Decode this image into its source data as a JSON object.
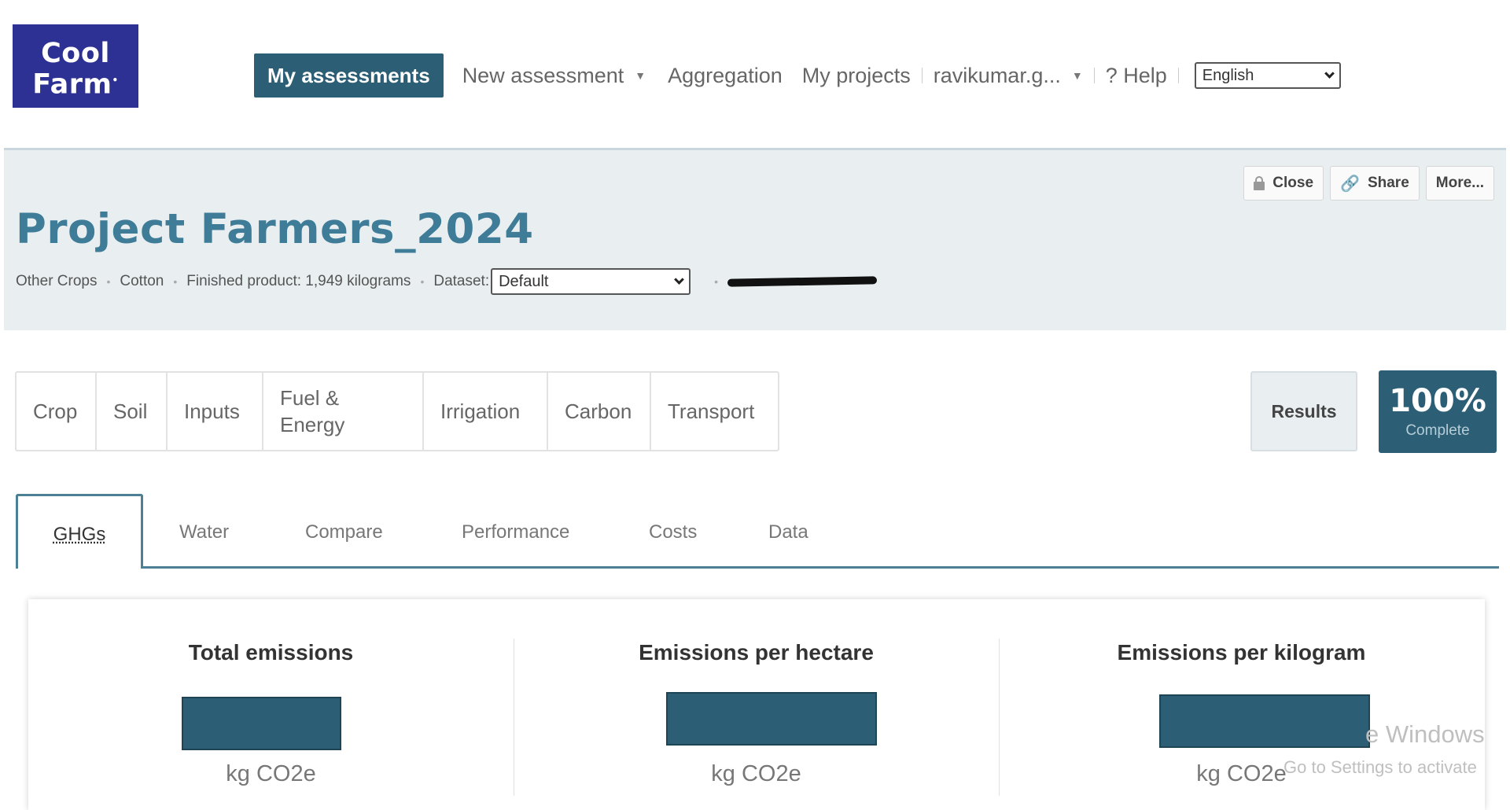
{
  "logo": {
    "line1": "Cool",
    "line2": "Farm",
    "mark": "•"
  },
  "nav": {
    "my_assessments": "My assessments",
    "new_assessment": "New assessment",
    "aggregation": "Aggregation",
    "my_projects": "My projects",
    "user": "ravikumar.g...",
    "help": "? Help",
    "language": "English"
  },
  "project": {
    "title": "Project Farmers_2024",
    "crop_group": "Other Crops",
    "crop": "Cotton",
    "finished_product": "Finished product: 1,949 kilograms",
    "dataset_label": "Dataset:",
    "dataset_value": "Default"
  },
  "actions": {
    "close": "Close",
    "share": "Share",
    "more": "More..."
  },
  "section_tabs": [
    "Crop",
    "Soil",
    "Inputs",
    "Fuel & Energy",
    "Irrigation",
    "Carbon",
    "Transport"
  ],
  "results_label": "Results",
  "completion": {
    "percent": "100%",
    "label": "Complete"
  },
  "result_tabs": [
    "GHGs",
    "Water",
    "Compare",
    "Performance",
    "Costs",
    "Data"
  ],
  "metrics": [
    {
      "title": "Total emissions",
      "unit": "kg CO2e"
    },
    {
      "title": "Emissions per hectare",
      "unit": "kg CO2e"
    },
    {
      "title": "Emissions per kilogram",
      "unit": "kg CO2e"
    }
  ],
  "watermark": {
    "line1": "e Windows",
    "line2": "Go to Settings to activate"
  },
  "colors": {
    "brand": "#2d3193",
    "primary": "#2c5f75",
    "title": "#3e7c97",
    "banner_bg": "#e9eef1"
  }
}
